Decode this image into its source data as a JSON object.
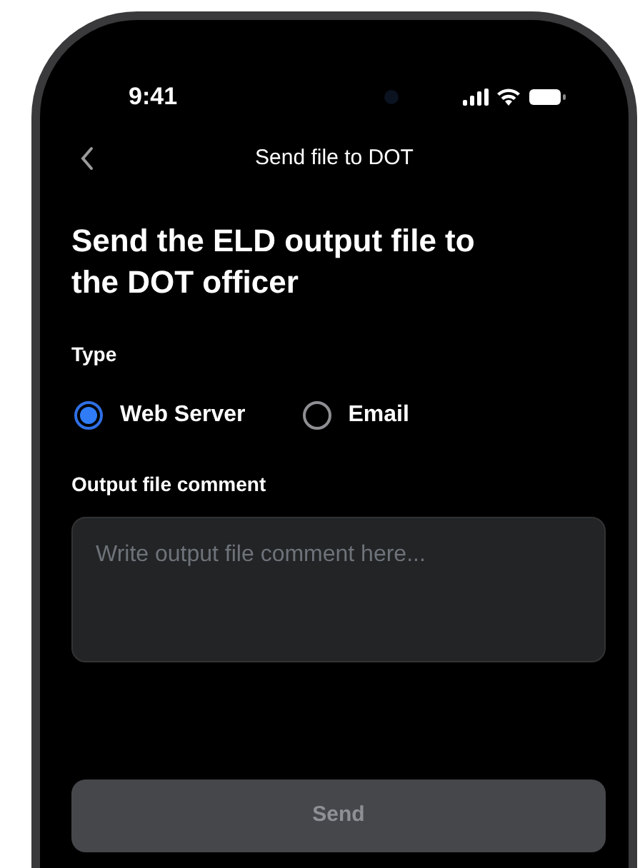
{
  "status_bar": {
    "time": "9:41"
  },
  "nav": {
    "title": "Send file to DOT"
  },
  "heading": "Send the ELD output file to the DOT officer",
  "type_label": "Type",
  "options": [
    {
      "label": "Web Server",
      "selected": true
    },
    {
      "label": "Email",
      "selected": false
    }
  ],
  "comment": {
    "label": "Output file comment",
    "placeholder": "Write output file comment here..."
  },
  "send_button": {
    "label": "Send",
    "disabled": true
  }
}
